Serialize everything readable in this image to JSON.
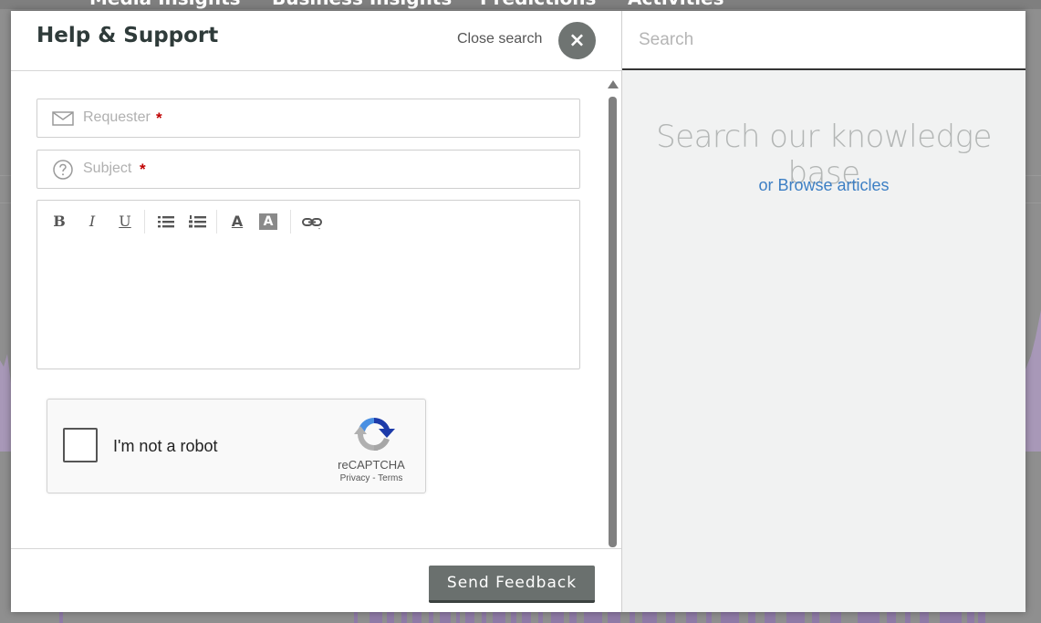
{
  "background": {
    "nav_items": [
      "Media Insights",
      "Business Insights",
      "Predictions",
      "Activities"
    ]
  },
  "modal": {
    "title": "Help & Support",
    "close_search_label": "Close search",
    "close_button_glyph": "×",
    "form": {
      "requester_placeholder": "Requester",
      "subject_placeholder": "Subject",
      "required_marker": "*",
      "toolbar": {
        "bold": "B",
        "italic": "I",
        "underline": "U",
        "font_color": "A",
        "highlight": "A"
      }
    },
    "recaptcha": {
      "label": "I'm not a robot",
      "brand": "reCAPTCHA",
      "links": "Privacy - Terms"
    },
    "send_button_label": "Send Feedback",
    "knowledge": {
      "search_placeholder": "Search",
      "title": "Search our knowledge base",
      "browse_link": "or Browse articles",
      "link_color": "#3d7fc4"
    }
  },
  "colors": {
    "overlay_gray": "#8f8f8f",
    "button_gray": "#6a706e",
    "required_red": "#c00000",
    "chart_purple": "#b39bcf"
  }
}
